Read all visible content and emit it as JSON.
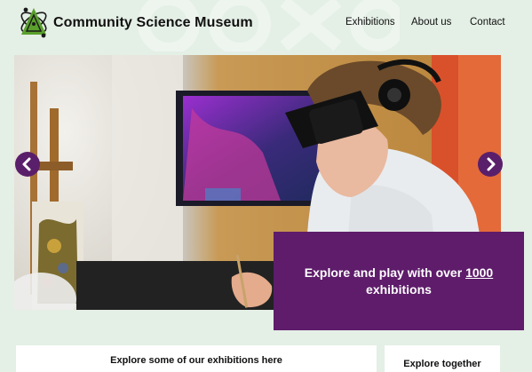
{
  "header": {
    "brand": "Community Science Museum",
    "nav": [
      "Exhibitions",
      "About us",
      "Contact"
    ]
  },
  "hero": {
    "promo_prefix": "Explore and play with over",
    "promo_number": "1000",
    "promo_suffix": "exhibitions"
  },
  "cards": [
    {
      "title": "Explore some of our exhibitions here"
    },
    {
      "title": "Explore together"
    }
  ],
  "colors": {
    "background": "#e4efe6",
    "accent": "#5e1c6a",
    "logo_green": "#5aa02c"
  },
  "icons": {
    "logo": "atom-logo-icon",
    "prev": "chevron-left-icon",
    "next": "chevron-right-icon"
  }
}
